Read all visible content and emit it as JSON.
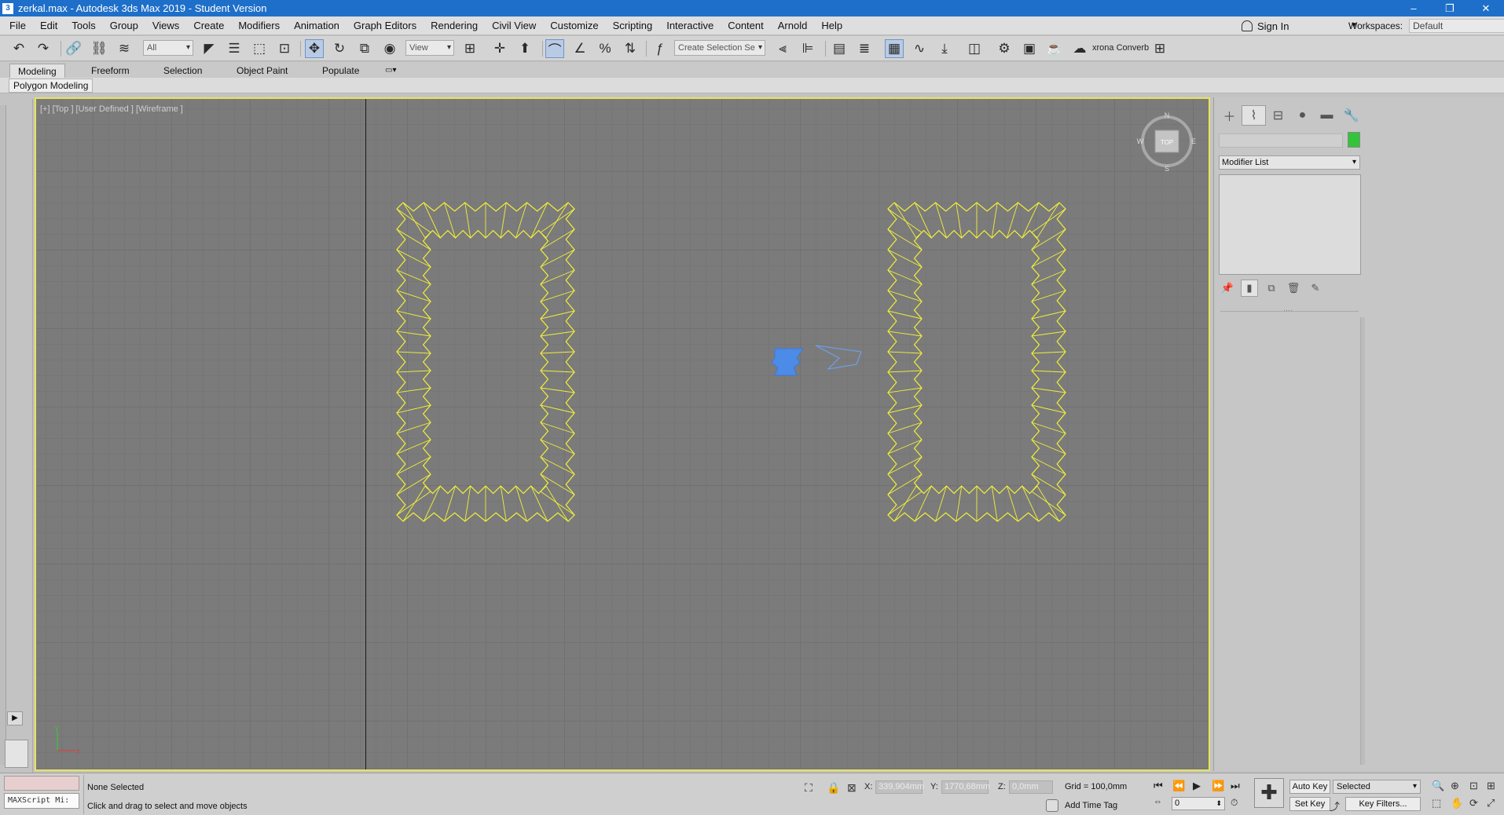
{
  "window": {
    "title": "zerkal.max - Autodesk 3ds Max 2019 - Student Version",
    "app_icon_letter": "3",
    "controls": [
      "–",
      "❐",
      "✕"
    ]
  },
  "menu": [
    "File",
    "Edit",
    "Tools",
    "Group",
    "Views",
    "Create",
    "Modifiers",
    "Animation",
    "Graph Editors",
    "Rendering",
    "Civil View",
    "Customize",
    "Scripting",
    "Interactive",
    "Content",
    "Arnold",
    "Help"
  ],
  "account": {
    "sign_in": "Sign In",
    "workspaces_label": "Workspaces:",
    "workspace_value": "Default"
  },
  "toolbar": {
    "selection_filter": "All",
    "ref_coord": "View",
    "named_selection": "Create Selection Se",
    "extra_label": "xrona Converb"
  },
  "ribbon": {
    "tabs": [
      "Modeling",
      "Freeform",
      "Selection",
      "Object Paint",
      "Populate"
    ],
    "panel_label": "Polygon Modeling"
  },
  "viewport": {
    "label": "[+] [Top ] [User Defined ] [Wireframe ]",
    "viewcube": {
      "face": "TOP",
      "n": "N",
      "s": "S",
      "e": "E",
      "w": "W"
    },
    "axis_x": "x",
    "axis_y": "y",
    "wire_color": "#f2f03a",
    "camera_color": "#4d8be8"
  },
  "command_panel": {
    "modifier_list": "Modifier List",
    "object_color": "#33c43a"
  },
  "status": {
    "script_label": "MAXScript Mi:",
    "selection": "None Selected",
    "hint": "Click and drag to select and move objects",
    "x_label": "X:",
    "x_value": "339,904mm",
    "y_label": "Y:",
    "y_value": "1770,68mm",
    "z_label": "Z:",
    "z_value": "0,0mm",
    "grid": "Grid = 100,0mm",
    "add_time_tag": "Add Time Tag",
    "frame": "0",
    "auto_key": "Auto Key",
    "set_key": "Set Key",
    "key_mode": "Selected",
    "key_filters": "Key Filters..."
  }
}
